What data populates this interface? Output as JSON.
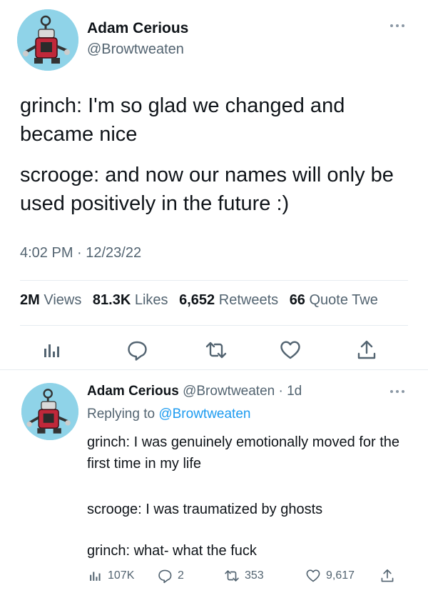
{
  "main_tweet": {
    "author_name": "Adam Cerious",
    "author_handle": "@Browtweaten",
    "text_line_1": "grinch: I'm so glad we changed and became nice",
    "text_line_2": "scrooge: and now our names will only be used positively in the future :)",
    "timestamp": "4:02 PM · 12/23/22"
  },
  "stats": {
    "views_count": "2M",
    "views_label": "Views",
    "likes_count": "81.3K",
    "likes_label": "Likes",
    "retweets_count": "6,652",
    "retweets_label": "Retweets",
    "quotes_count": "66",
    "quotes_label": "Quote Twe"
  },
  "reply_tweet": {
    "author_name": "Adam Cerious",
    "author_handle": "@Browtweaten",
    "time_ago": "· 1d",
    "replying_prefix": "Replying to",
    "replying_to": "@Browtweaten",
    "text_line_1": "grinch: I was genuinely emotionally moved for the first time in my life",
    "text_line_2": "scrooge: I was traumatized by ghosts",
    "text_line_3": "grinch: what- what the fuck",
    "views": "107K",
    "replies": "2",
    "retweets": "353",
    "likes": "9,617"
  },
  "icons": {
    "analytics": "bar-chart-icon",
    "reply": "speech-bubble-icon",
    "retweet": "retweet-arrows-icon",
    "like": "heart-icon",
    "share": "upload-arrow-icon",
    "more": "ellipsis-icon"
  },
  "colors": {
    "text": "#0f1419",
    "secondary": "#536471",
    "link": "#1d9bf0",
    "avatar_bg": "#8fd3e8",
    "robot": "#c0283a"
  }
}
